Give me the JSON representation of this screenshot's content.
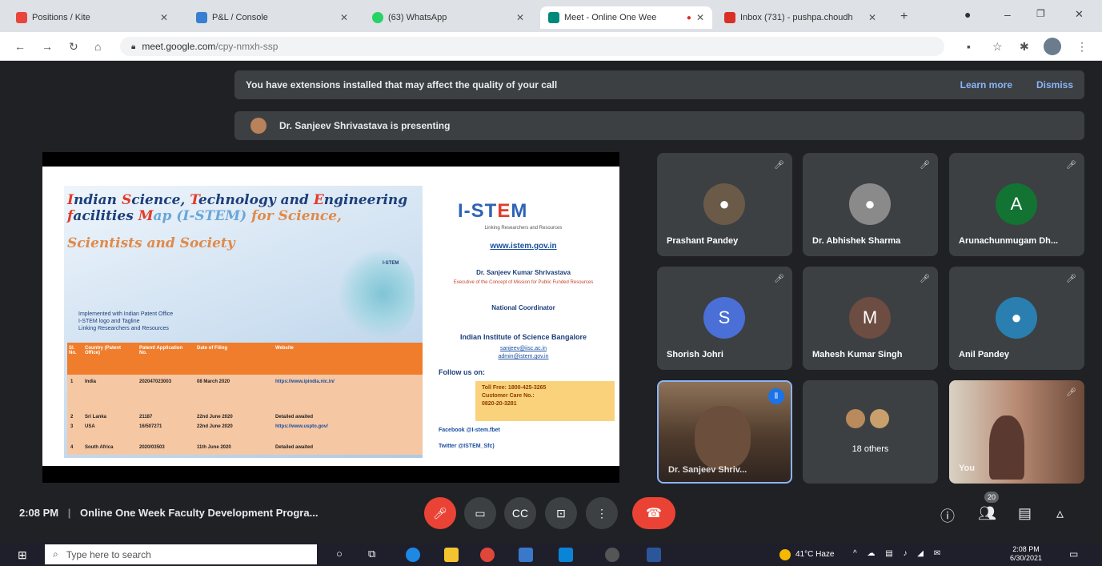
{
  "browser": {
    "tabs": [
      {
        "title": "Positions / Kite",
        "color": "#e8453c"
      },
      {
        "title": "P&L / Console",
        "color": "#387ed1"
      },
      {
        "title": "(63) WhatsApp",
        "color": "#25d366"
      },
      {
        "title": "Meet - Online One Wee",
        "color": "#00897b"
      },
      {
        "title": "Inbox (731) - pushpa.choudh",
        "color": "#d93025"
      }
    ],
    "new_tab": "+",
    "url_host": "meet.google.com",
    "url_path": "/cpy-nmxh-ssp"
  },
  "meet": {
    "extension_banner": "You have extensions installed that may affect the quality of your call",
    "learn_more": "Learn more",
    "dismiss": "Dismiss",
    "presenting": "Dr. Sanjeev Shrivastava is presenting",
    "slide": {
      "title_line1_parts": [
        "I",
        "ndian ",
        "S",
        "cience, ",
        "T",
        "echnology and ",
        "E",
        "ngineering"
      ],
      "title_line2_parts": [
        "f",
        "acilities ",
        "M",
        "ap (I-STEM) ",
        "f",
        "or Science,"
      ],
      "title_line3": "Scientists and Society",
      "map_label": "I-STEM",
      "subtitle_lines": [
        "Implemented with Indian Patent Office",
        "I-STEM logo and Tagline",
        "Linking Researchers and Resources"
      ],
      "table_headers": [
        "Sl. No.",
        "Country (Patent Office)",
        "Patent/ Application No.",
        "Date of Filing",
        "Website"
      ],
      "table_rows": [
        [
          "1",
          "India",
          "202047023003",
          "08 March 2020",
          "https://www.ipindia.nic.in/"
        ],
        [
          "2",
          "Sri Lanka",
          "21187",
          "22nd June 2020",
          "Detailed awaited"
        ],
        [
          "3",
          "USA",
          "16/507271",
          "22nd June 2020",
          "https://www.uspto.gov/"
        ],
        [
          "4",
          "South Africa",
          "2020/03503",
          "11th June 2020",
          "Detailed awaited"
        ]
      ],
      "logo_left": "I-ST",
      "logo_mid": "E",
      "logo_right": "M",
      "tagline": "Linking Researchers and Resources",
      "website": "www.istem.gov.in",
      "person": "Dr. Sanjeev Kumar Shrivastava",
      "role": "Executive of the Concept of Mission for Public Funded Resources",
      "coordinator": "National Coordinator",
      "institute": "Indian Institute of Science Bangalore",
      "emails": [
        "sanjeev@iisc.ac.in",
        "admin@istem.gov.in"
      ],
      "follow": "Follow us on:",
      "toll_free": "Toll Free: 1800-425-3265",
      "care_label": "Customer Care No.:",
      "care_no": "0820-20-3281",
      "facebook": "Facebook @I-stem.fbet",
      "twitter": "Twitter @ISTEM_Sfc)"
    },
    "participants": [
      {
        "name": "Prashant Pandey",
        "type": "photo",
        "color": "#6b5a48"
      },
      {
        "name": "Dr. Abhishek Sharma",
        "type": "photo",
        "color": "#8a8a8a"
      },
      {
        "name": "Arunachunmugam Dh...",
        "type": "letter",
        "letter": "A",
        "color": "#137333"
      },
      {
        "name": "Shorish Johri",
        "type": "letter",
        "letter": "S",
        "color": "#4a6fd6"
      },
      {
        "name": "Mahesh Kumar Singh",
        "type": "letter",
        "letter": "M",
        "color": "#6d4c41"
      },
      {
        "name": "Anil Pandey",
        "type": "photo",
        "color": "#2a7fb0"
      },
      {
        "name": "Dr. Sanjeev Shriv...",
        "type": "video"
      },
      {
        "name": "18 others",
        "type": "others"
      },
      {
        "name": "You",
        "type": "video2"
      }
    ],
    "time": "2:08 PM",
    "meeting_title": "Online One Week Faculty Development Progra...",
    "participant_count": "20"
  },
  "taskbar": {
    "search_placeholder": "Type here to search",
    "weather": "41°C Haze",
    "clock_time": "2:08 PM",
    "clock_date": "6/30/2021"
  }
}
